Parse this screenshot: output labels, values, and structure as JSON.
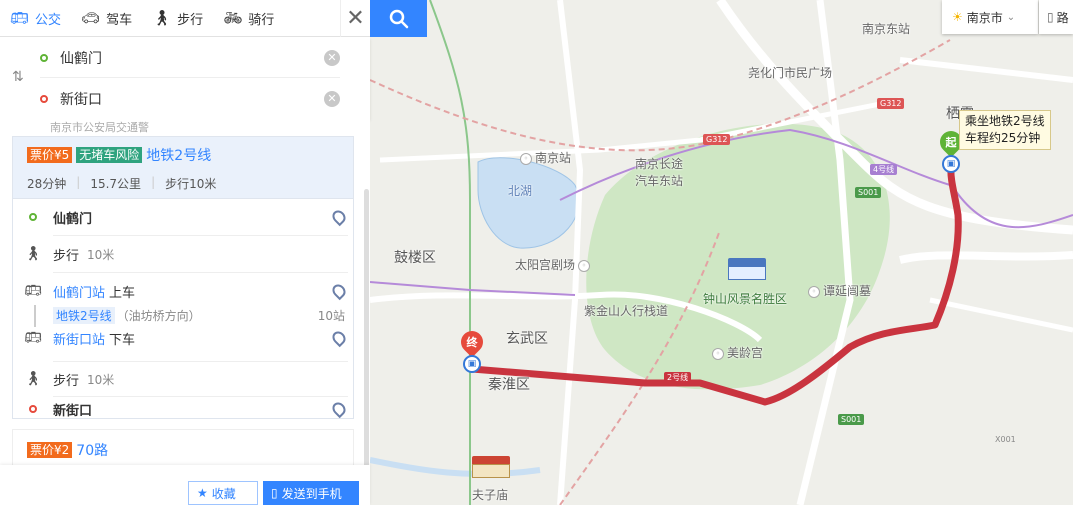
{
  "app": {
    "modes": [
      {
        "label": "公交",
        "icon": "bus-icon",
        "active": true
      },
      {
        "label": "驾车",
        "icon": "car-icon",
        "active": false
      },
      {
        "label": "步行",
        "icon": "walk-icon",
        "active": false
      },
      {
        "label": "骑行",
        "icon": "bike-icon",
        "active": false
      }
    ],
    "accent": "#3385ff"
  },
  "route_input": {
    "start": "仙鹤门",
    "end": "新街口"
  },
  "city": {
    "name": "南京市",
    "road_label": "路"
  },
  "results": {
    "peek_text": "南京市公安局交通警",
    "plan1": {
      "fare": "票价¥5",
      "safety": "无堵车风险",
      "line": "地铁2号线",
      "duration": "28分钟",
      "distance": "15.7公里",
      "walk": "步行10米",
      "steps": {
        "start_name": "仙鹤门",
        "walk1_label": "步行",
        "walk1_dist": "10米",
        "board_station": "仙鹤门站",
        "board_action": "上车",
        "line_chip": "地铁2号线",
        "direction": "（油坊桥方向）",
        "stops": "10站",
        "alight_station": "新街口站",
        "alight_action": "下车",
        "walk2_label": "步行",
        "walk2_dist": "10米",
        "end_name": "新街口"
      }
    },
    "plan2": {
      "fare": "票价¥2",
      "line": "70路"
    }
  },
  "footer": {
    "favorite": "收藏",
    "send": "发送到手机"
  },
  "map": {
    "labels": {
      "nanjing_east": "南京东站",
      "yaohua": "尧化门市民广场",
      "qixia": "栖霞",
      "nanjing_station": "南京站",
      "bus_station_1": "南京长途",
      "bus_station_2": "汽车东站",
      "beihu": "北湖",
      "gulou": "鼓楼区",
      "taiyanggong": "太阳宫剧场",
      "zhongshan": "钟山风景名胜区",
      "tanyan": "谭延闿墓",
      "zijinshan": "紫金山人行栈道",
      "xuanwu": "玄武区",
      "meiling": "美龄宫",
      "qinhuai": "秦淮区",
      "fuzimiao": "夫子庙"
    },
    "road_tags": {
      "g312a": "G312",
      "g312b": "G312",
      "line4": "4号线",
      "line2": "2号线",
      "s001a": "S001",
      "s001b": "S001",
      "x001": "X001"
    },
    "start_marker": "起",
    "end_marker": "终",
    "tooltip_line1": "乘坐地铁2号线",
    "tooltip_line2": "车程约25分钟",
    "route_color": "#c9343f"
  }
}
